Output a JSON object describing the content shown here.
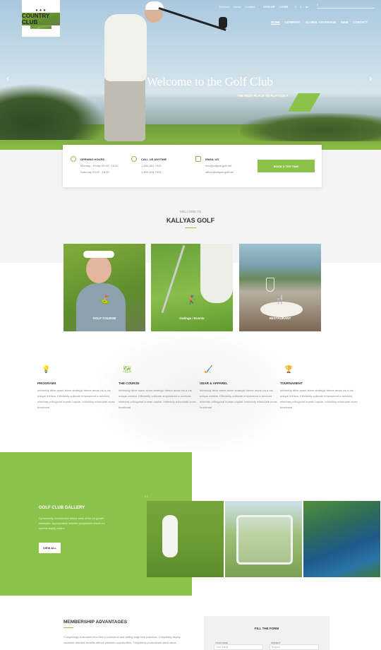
{
  "header": {
    "logo": {
      "line1": "COUNTRY CLUB",
      "line2": "GOLF COURSE",
      "stars": "★★★"
    },
    "topbar": {
      "links": [
        "Services",
        "News",
        "Contact"
      ],
      "signup": "SIGN UP",
      "login": "LOGIN",
      "social": [
        "f",
        "t",
        "in"
      ]
    },
    "nav": [
      "HOME",
      "COMPANY",
      "GLOBAL COVERAGE",
      "NEW",
      "CONTACT"
    ]
  },
  "hero": {
    "title": "Welcome to the Golf Club",
    "subtitle": "THE BEST PLACE TO PLAY GOLF",
    "prev": "‹",
    "next": "›"
  },
  "info": {
    "hours": {
      "title": "OPENING HOURS",
      "line1": "Monday - Friday 09:00 - 18:30",
      "line2": "Saturday 09:00 - 18:30"
    },
    "call": {
      "title": "CALL US ANYTIME",
      "line1": "1-800-634-7923",
      "line2": "1-800-634-7924"
    },
    "email": {
      "title": "EMAIL US",
      "line1": "info@kallyas-golf.net",
      "line2": "office@kallyas-golf.net"
    },
    "button": "BOOK A TEE TIME"
  },
  "intro": {
    "small": "WELCOME TO",
    "title": "KALLYAS GOLF"
  },
  "tiles": [
    {
      "label": "GOLF COURSE"
    },
    {
      "label": "Outings / Events"
    },
    {
      "label": "RESTAURANT"
    }
  ],
  "features": [
    {
      "title": "PROGRAMS",
      "text": "Intrinsicly drive stand alone strategic theme areas vis-a-vis unique metrics. Efficiently cultivate empowered e-services whereas orthogonal human capital. Intrinsicly evisculate cross functional"
    },
    {
      "title": "THE COURSE",
      "text": "Intrinsicly drive stand alone strategic theme areas vis-a-vis unique metrics. Efficiently cultivate empowered e-services whereas orthogonal human capital. Intrinsicly evisculate cross functional"
    },
    {
      "title": "GEAR & APPAREL",
      "text": "Intrinsicly drive stand alone strategic theme areas vis-a-vis unique metrics. Efficiently cultivate empowered e-services whereas orthogonal human capital. Intrinsicly evisculate cross functional"
    },
    {
      "title": "TOURNAMENT",
      "text": "Intrinsicly drive stand alone strategic theme areas vis-a-vis unique metrics. Efficiently cultivate empowered e-services whereas orthogonal human capital. Intrinsicly evisculate cross functional"
    }
  ],
  "gallery": {
    "title": "GOLF CLUB GALLERY",
    "text": "Dynamically revolutionize before state of the art growth strategies. Appropriately redefine prospective results for optimal supply chains.",
    "button": "VIEW ALL",
    "nav": "‹ ›"
  },
  "membership": {
    "title": "MEMBERSHIP ADVANTAGES",
    "text": "Compellingly evisculate error-free e-commerce and cutting-edge best practices. Completely deploy customer directed benefits without premium opportunities. Completely productivate stand alone"
  },
  "form": {
    "title": "FILL THE FORM",
    "name_label": "YOUR NAME",
    "name_placeholder": "Your Name",
    "subject_label": "SUBJECT",
    "subject_placeholder": "Subject"
  },
  "colors": {
    "accent": "#8bc34a"
  }
}
